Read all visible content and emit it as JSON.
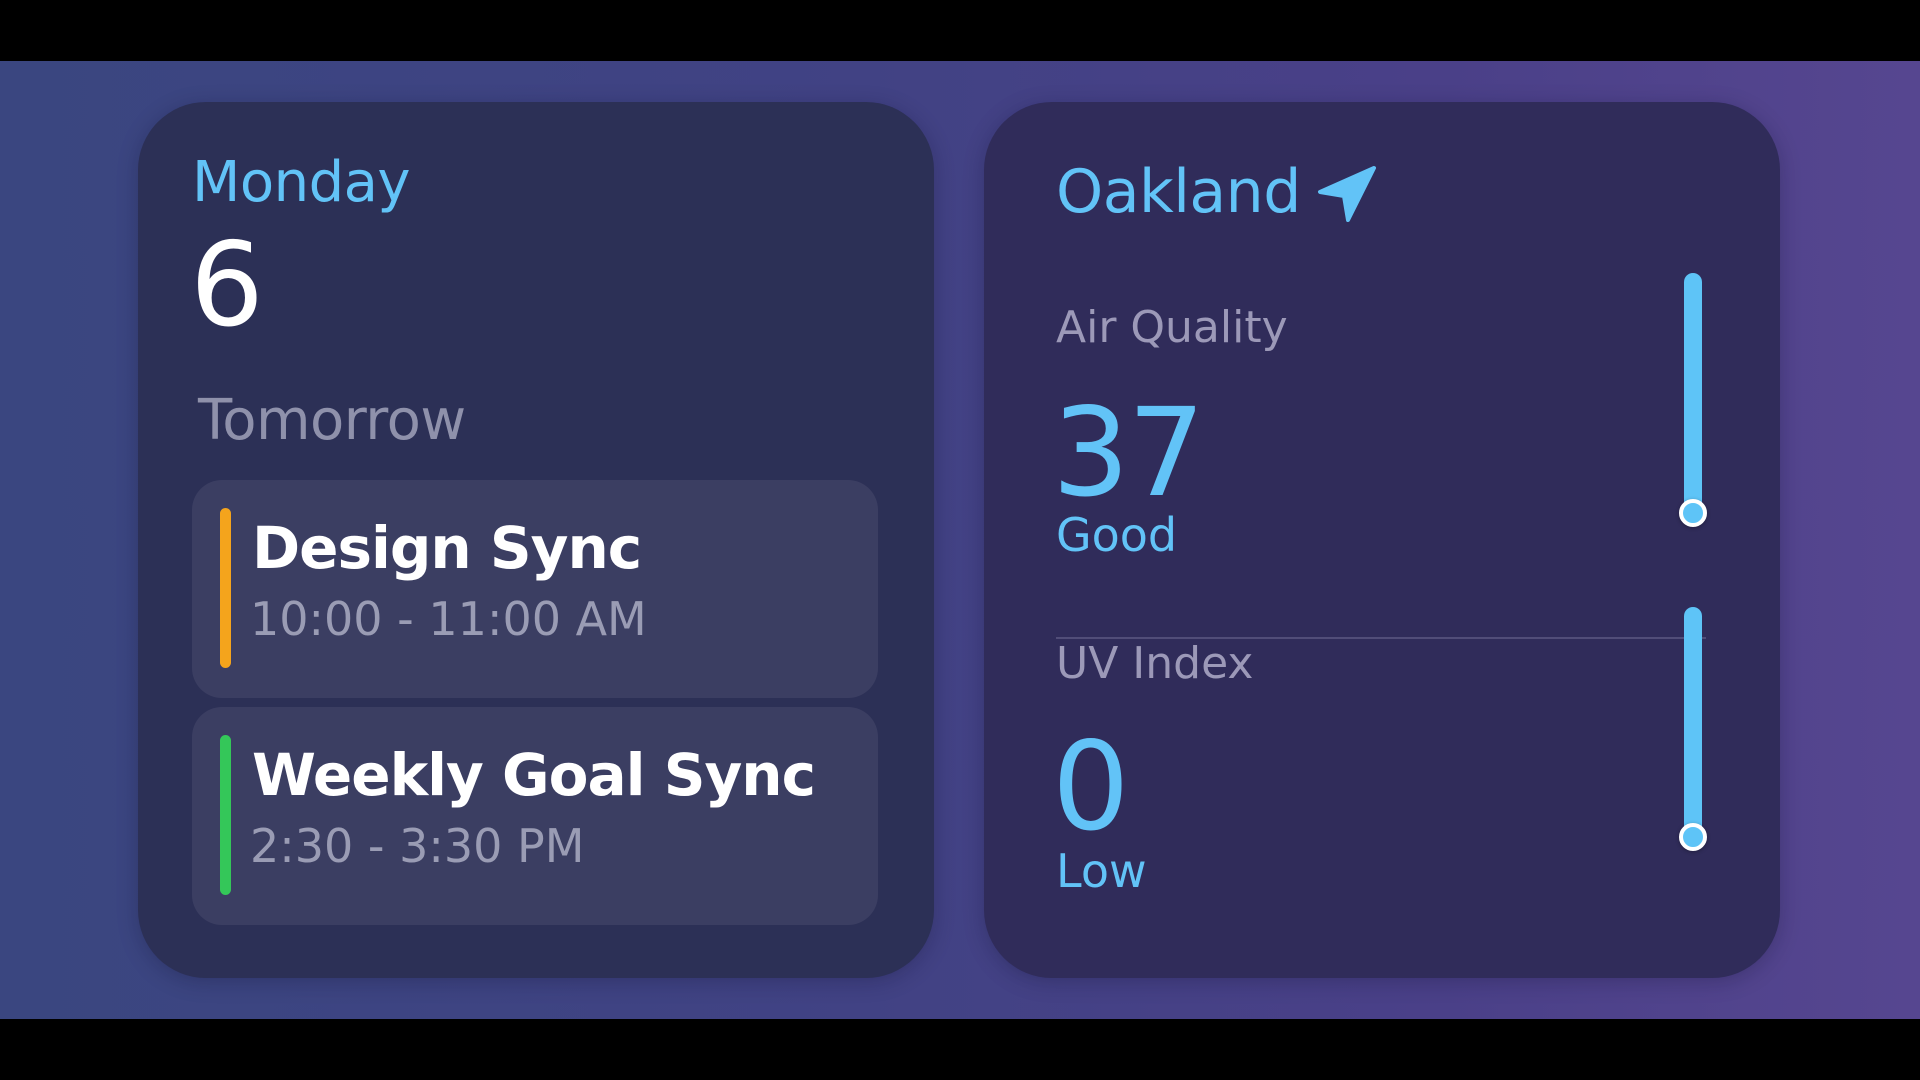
{
  "calendar": {
    "day_name": "Monday",
    "date": "6",
    "section_label": "Tomorrow",
    "events": [
      {
        "title": "Design Sync",
        "time": "10:00 - 11:00 AM",
        "color": "#f4a41c"
      },
      {
        "title": "Weekly Goal Sync",
        "time": "2:30 - 3:30 PM",
        "color": "#34c759"
      }
    ]
  },
  "weather": {
    "city": "Oakland",
    "location_icon": "location-arrow-icon",
    "accent_color": "#62c3f7",
    "metrics": [
      {
        "label": "Air Quality",
        "value": "37",
        "description": "Good",
        "level_fraction": 0.15
      },
      {
        "label": "UV Index",
        "value": "0",
        "description": "Low",
        "level_fraction": 0.0
      }
    ]
  }
}
